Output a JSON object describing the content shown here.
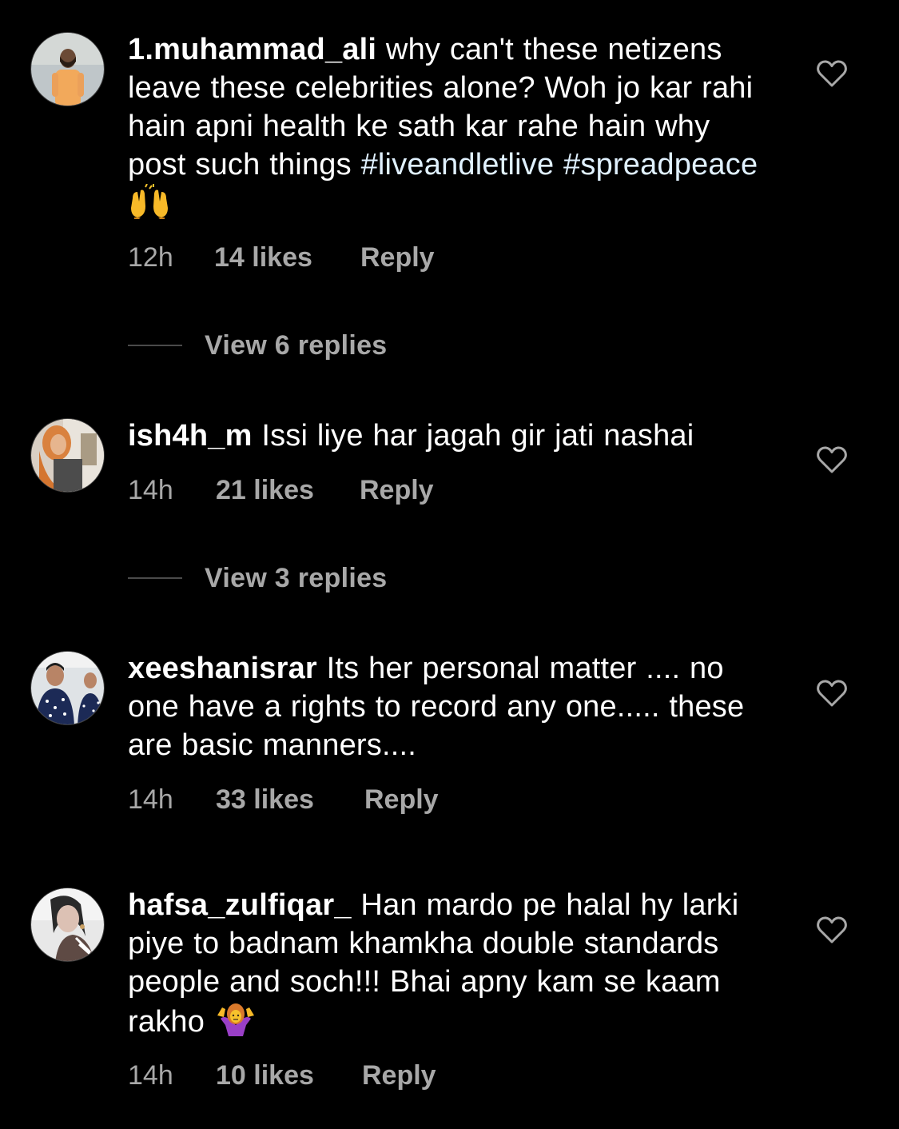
{
  "comments": [
    {
      "username": "1.muhammad_ali",
      "text": "why can't these netizens leave these celebrities alone? Woh jo kar rahi hain apni health ke sath kar rahe hain why post such things",
      "hashtags": "#liveandletlive #spreadpeace",
      "emoji": "raising-hands-emoji",
      "time": "12h",
      "likes": "14 likes",
      "reply": "Reply",
      "view_replies": "View 6 replies"
    },
    {
      "username": "ish4h_m",
      "text": "Issi liye har jagah gir jati nashai",
      "time": "14h",
      "likes": "21 likes",
      "reply": "Reply",
      "view_replies": "View 3 replies"
    },
    {
      "username": "xeeshanisrar",
      "text": "Its her personal matter .... no one have a rights to record any one..... these are basic manners....",
      "time": "14h",
      "likes": "33 likes",
      "reply": "Reply"
    },
    {
      "username": "hafsa_zulfiqar_",
      "text": "Han mardo pe halal hy larki piye to badnam khamkha double standards people and soch!!! Bhai apny kam se kaam rakho",
      "emoji": "person-shrugging-emoji",
      "time": "14h",
      "likes": "10 likes",
      "reply": "Reply"
    }
  ],
  "icons": {
    "like": "heart-outline-icon"
  },
  "colors": {
    "background": "#000000",
    "text": "#ffffff",
    "secondary": "#a8a8a8",
    "hashtag": "#e0f1ff"
  }
}
